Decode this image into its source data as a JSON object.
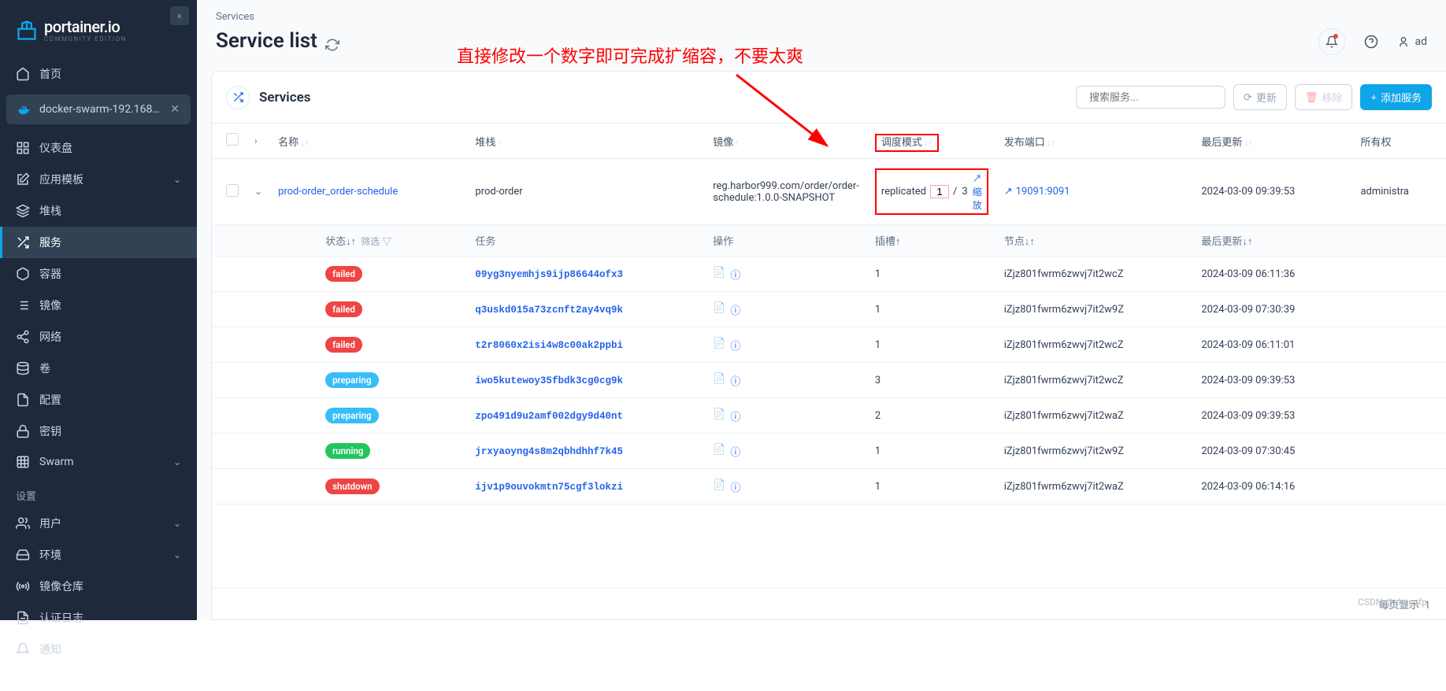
{
  "logo": {
    "name": "portainer.io",
    "sub": "COMMUNITY EDITION"
  },
  "sidebar": {
    "home": "首页",
    "env": "docker-swarm-192.168.13...",
    "items": [
      {
        "label": "仪表盘",
        "icon": "dashboard",
        "chevron": false
      },
      {
        "label": "应用模板",
        "icon": "template",
        "chevron": true
      },
      {
        "label": "堆栈",
        "icon": "layers",
        "chevron": false
      },
      {
        "label": "服务",
        "icon": "shuffle",
        "chevron": false,
        "active": true
      },
      {
        "label": "容器",
        "icon": "box",
        "chevron": false
      },
      {
        "label": "镜像",
        "icon": "list",
        "chevron": false
      },
      {
        "label": "网络",
        "icon": "share",
        "chevron": false
      },
      {
        "label": "卷",
        "icon": "database",
        "chevron": false
      },
      {
        "label": "配置",
        "icon": "file",
        "chevron": false
      },
      {
        "label": "密钥",
        "icon": "lock",
        "chevron": false
      },
      {
        "label": "Swarm",
        "icon": "grid",
        "chevron": true
      }
    ],
    "section_settings": "设置",
    "settings_items": [
      {
        "label": "用户",
        "icon": "users",
        "chevron": true
      },
      {
        "label": "环境",
        "icon": "hdd",
        "chevron": true
      },
      {
        "label": "镜像仓库",
        "icon": "radio",
        "chevron": false
      },
      {
        "label": "认证日志",
        "icon": "file-text",
        "chevron": false
      },
      {
        "label": "通知",
        "icon": "bell",
        "chevron": false
      }
    ]
  },
  "breadcrumb": "Services",
  "page_title": "Service list",
  "annotation": "直接修改一个数字即可完成扩缩容，不要太爽",
  "user": "ad",
  "panel": {
    "title": "Services",
    "search_placeholder": "搜索服务...",
    "btn_update": "更新",
    "btn_remove": "移除",
    "btn_add": "添加服务"
  },
  "columns": {
    "name": "名称",
    "stack": "堆栈",
    "image": "镜像",
    "sched_mode": "调度模式",
    "ports": "发布端口",
    "updated": "最后更新",
    "owner": "所有权"
  },
  "service_row": {
    "name": "prod-order_order-schedule",
    "stack": "prod-order",
    "image": "reg.harbor999.com/order/order-schedule:1.0.0-SNAPSHOT",
    "mode": "replicated",
    "current": "1",
    "target": "3",
    "scale_label": "缩放",
    "port": "19091:9091",
    "updated": "2024-03-09 09:39:53",
    "owner": "administra"
  },
  "sub_columns": {
    "status": "状态",
    "filter": "筛选",
    "task": "任务",
    "actions": "操作",
    "slot": "插槽",
    "node": "节点",
    "updated": "最后更新"
  },
  "tasks": [
    {
      "status": "failed",
      "status_class": "status-failed",
      "id": "09yg3nyemhjs9ijp86644ofx3",
      "slot": "1",
      "node": "iZjz801fwrm6zwvj7it2wcZ",
      "updated": "2024-03-09 06:11:36"
    },
    {
      "status": "failed",
      "status_class": "status-failed",
      "id": "q3uskd015a73zcnft2ay4vq9k",
      "slot": "1",
      "node": "iZjz801fwrm6zwvj7it2w9Z",
      "updated": "2024-03-09 07:30:39"
    },
    {
      "status": "failed",
      "status_class": "status-failed",
      "id": "t2r8060x2isi4w8c00ak2ppbi",
      "slot": "1",
      "node": "iZjz801fwrm6zwvj7it2wcZ",
      "updated": "2024-03-09 06:11:01"
    },
    {
      "status": "preparing",
      "status_class": "status-preparing",
      "id": "iwo5kutewoy35fbdk3cg0cg9k",
      "slot": "3",
      "node": "iZjz801fwrm6zwvj7it2wcZ",
      "updated": "2024-03-09 09:39:53"
    },
    {
      "status": "preparing",
      "status_class": "status-preparing",
      "id": "zpo491d9u2amf002dgy9d40nt",
      "slot": "2",
      "node": "iZjz801fwrm6zwvj7it2waZ",
      "updated": "2024-03-09 09:39:53"
    },
    {
      "status": "running",
      "status_class": "status-running",
      "id": "jrxyaoyng4s8m2qbhdhhf7k45",
      "slot": "1",
      "node": "iZjz801fwrm6zwvj7it2w9Z",
      "updated": "2024-03-09 07:30:45"
    },
    {
      "status": "shutdown",
      "status_class": "status-shutdown",
      "id": "ijv1p9ouvokmtn75cgf3lokzi",
      "slot": "1",
      "node": "iZjz801fwrm6zwvj7it2waZ",
      "updated": "2024-03-09 06:14:16"
    }
  ],
  "footer": {
    "per_page": "每页显示",
    "value": "1"
  },
  "watermark": "CSDN @chenzfp"
}
